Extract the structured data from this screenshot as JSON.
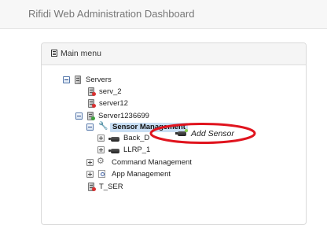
{
  "app": {
    "title": "Rifidi Web Administration Dashboard"
  },
  "panel": {
    "title": "Main menu"
  },
  "tree": {
    "root_label": "Servers",
    "serv_2": "serv_2",
    "server12": "server12",
    "server1236699": "Server1236699",
    "sensor_management": "Sensor Management",
    "back_door": "Back_D",
    "llrp_1": "LLRP_1",
    "command_management": "Command Management",
    "app_management": "App Management",
    "t_ser": "T_SER"
  },
  "context_menu": {
    "add_sensor": "Add Sensor"
  },
  "colors": {
    "highlight": "#e0141e",
    "selection": "#c8def4"
  }
}
